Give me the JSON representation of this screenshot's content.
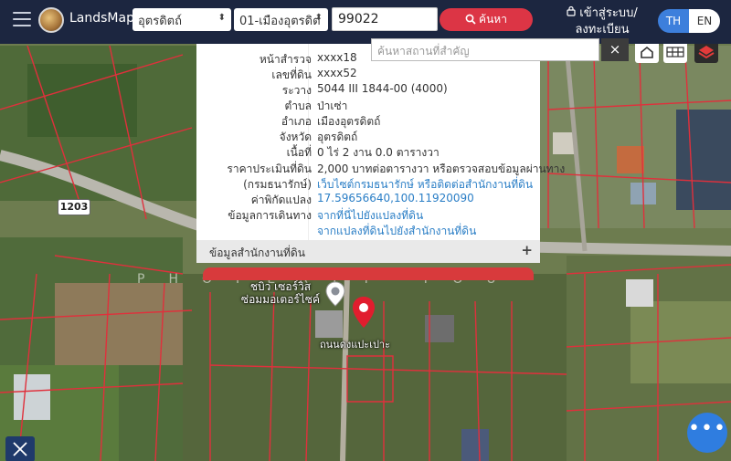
{
  "header": {
    "brand": "LandsMaps",
    "province_select": "อุตรดิตถ์",
    "district_select": "01-เมืองอุตรดิต",
    "parcel_number": "99022",
    "search_label": "ค้นหา",
    "login_label": "เข้าสู่ระบบ/ลงทะเบียน",
    "lang_th": "TH",
    "lang_en": "EN"
  },
  "place_search": {
    "placeholder": "ค้นหาสถานที่สำคัญ",
    "close": "×"
  },
  "parcel_info": {
    "rows": [
      {
        "label": "หน้าสำรวจ",
        "value": "xxxx18"
      },
      {
        "label": "เลขที่ดิน",
        "value": "xxxx52"
      },
      {
        "label": "ระวาง",
        "value": "5044 III 1844-00 (4000)"
      },
      {
        "label": "ตำบล",
        "value": "ป่าเซ่า"
      },
      {
        "label": "อำเภอ",
        "value": "เมืองอุตรดิตถ์"
      },
      {
        "label": "จังหวัด",
        "value": "อุตรดิตถ์"
      },
      {
        "label": "เนื้อที่",
        "value": "0 ไร่ 2 งาน 0.0 ตารางวา"
      },
      {
        "label": "ราคาประเมินที่ดิน",
        "value": "2,000 บาทต่อตารางวา หรือตรวจสอบข้อมูลผ่านทาง"
      },
      {
        "label": "(กรมธนารักษ์)",
        "value": "เว็บไซต์กรมธนารักษ์ หรือติดต่อสำนักงานที่ดิน"
      },
      {
        "label": "ค่าพิกัดแปลง",
        "value": "17.59656640,100.11920090"
      },
      {
        "label": "ข้อมูลการเดินทาง",
        "value": "จากที่นี่ไปยังแปลงที่ดิน"
      },
      {
        "label": "",
        "value": "จากแปลงที่ดินไปยังสำนักงานที่ดิน"
      }
    ],
    "office_section": "ข้อมูลสำนักงานที่ดิน",
    "office_toggle": "+"
  },
  "map": {
    "road_number": "1203",
    "place_label": "ชบิว เซอร์วิส ซ่อมมอเตอร์ไซค์",
    "street_label": "ถนนดงแปะเปาะ",
    "watermark": "PHOPERTY YOU"
  },
  "fab_label": "•••",
  "colors": {
    "header_bg": "#1c2640",
    "search_red": "#dc3545",
    "lang_active": "#3d7fdc",
    "link_blue": "#2a7ec6",
    "parcel_line": "#e0303c",
    "fab_blue": "#2f7de0"
  }
}
